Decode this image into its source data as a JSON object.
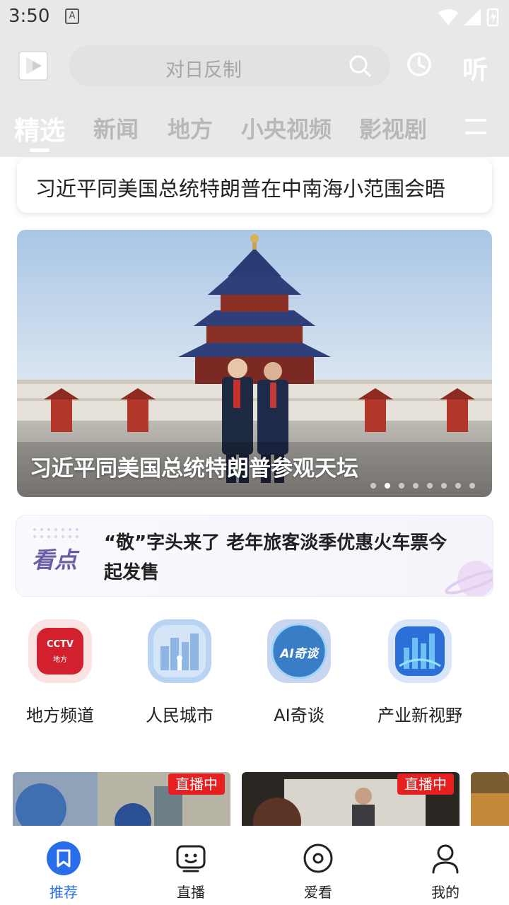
{
  "status_bar": {
    "time": "3:50",
    "app_badge": "A"
  },
  "header": {
    "search_placeholder": "对日反制",
    "listen_label": "听"
  },
  "tabs": [
    {
      "label": "精选",
      "active": true
    },
    {
      "label": "新闻"
    },
    {
      "label": "地方"
    },
    {
      "label": "小央视频"
    },
    {
      "label": "影视剧"
    }
  ],
  "headline": {
    "text": "习近平同美国总统特朗普在中南海小范围会晤"
  },
  "banner": {
    "caption": "习近平同美国总统特朗普参观天坛",
    "dots_total": 8,
    "active_dot": 2
  },
  "kandian": {
    "logo": "看点",
    "text": "“敬”字头来了 老年旅客淡季优惠火车票今起发售"
  },
  "channels": [
    {
      "label": "地方频道",
      "icon": "cctv-local-icon",
      "icon_text": "CCTV",
      "icon_sub": "地方"
    },
    {
      "label": "人民城市",
      "icon": "city-icon"
    },
    {
      "label": "AI奇谈",
      "icon": "ai-talk-icon",
      "icon_text": "AI奇谈"
    },
    {
      "label": "产业新视野",
      "icon": "industry-icon"
    }
  ],
  "live": [
    {
      "badge": "直播中"
    },
    {
      "badge": "直播中"
    }
  ],
  "bottom_nav": [
    {
      "label": "推荐",
      "icon": "bookmark-icon",
      "active": true
    },
    {
      "label": "直播",
      "icon": "tv-face-icon"
    },
    {
      "label": "爱看",
      "icon": "disc-icon"
    },
    {
      "label": "我的",
      "icon": "person-icon"
    }
  ],
  "colors": {
    "accent": "#2a6dea",
    "live_badge": "#e62020",
    "header_bg": "#e8e8e8"
  }
}
